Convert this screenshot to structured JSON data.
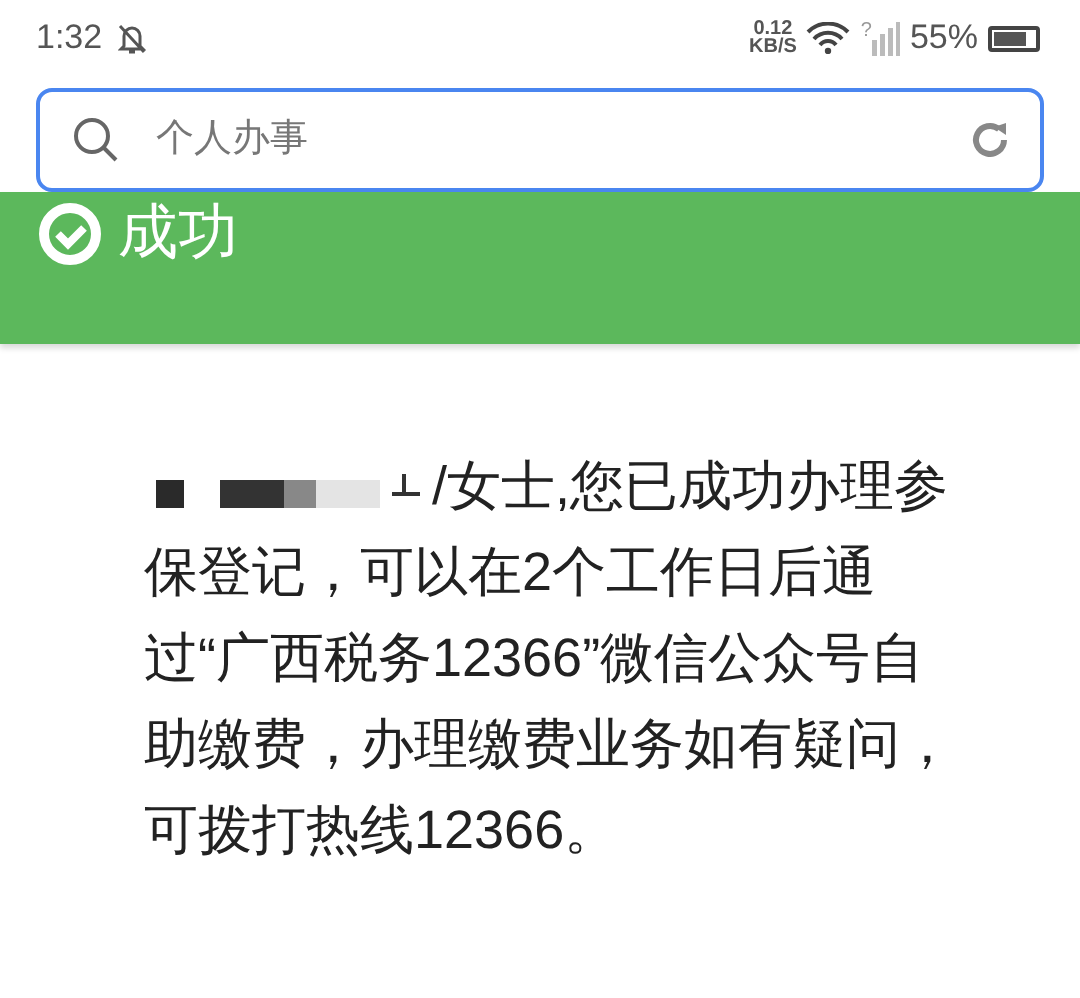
{
  "status_bar": {
    "time": "1:32",
    "speed_value": "0.12",
    "speed_unit": "KB/S",
    "signal_unknown": "?",
    "battery_percent": "55%"
  },
  "search": {
    "placeholder": "个人办事",
    "focused": true
  },
  "banner": {
    "title": "成功"
  },
  "message": {
    "redacted": true,
    "lines": [
      "/女士,您已成功办理参",
      "保登记，可以在2个工作日后通",
      "过“广西税务12366”微信公众号自",
      "助缴费，办理缴费业务如有疑问，",
      "可拨打热线12366。"
    ]
  }
}
